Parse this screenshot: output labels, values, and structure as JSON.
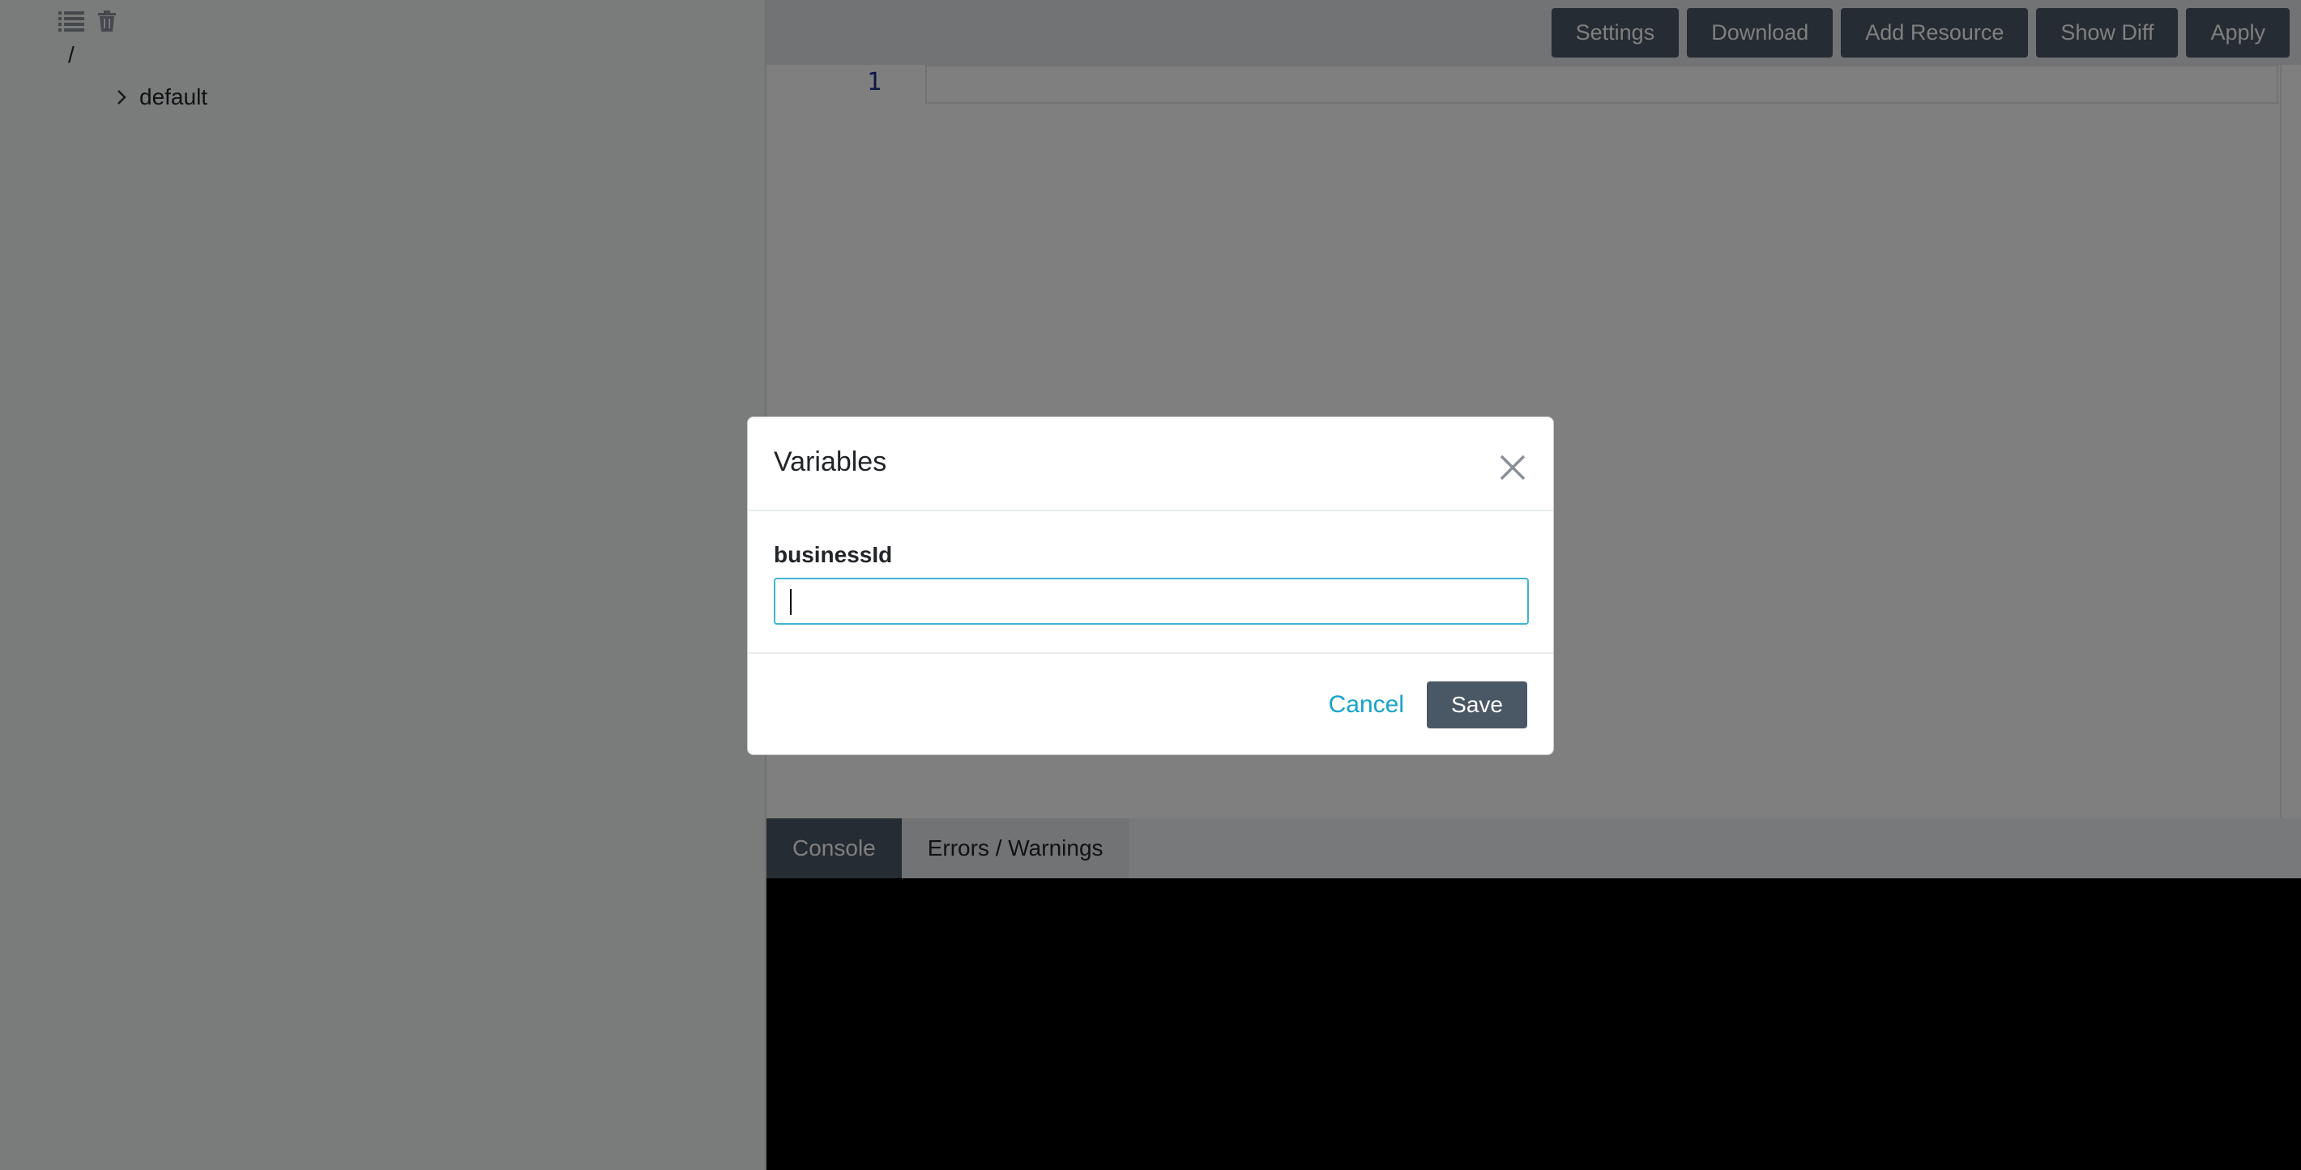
{
  "sidebar": {
    "icons": [
      "list-icon",
      "trash-icon"
    ],
    "tree_root": "/",
    "tree_items": [
      {
        "label": "default",
        "expanded": false
      }
    ]
  },
  "toolbar": {
    "buttons": [
      "Settings",
      "Download",
      "Add Resource",
      "Show Diff",
      "Apply"
    ]
  },
  "editor": {
    "line_numbers": [
      "1"
    ]
  },
  "panel": {
    "tabs": [
      "Console",
      "Errors / Warnings"
    ],
    "active_tab": "Console"
  },
  "modal": {
    "title": "Variables",
    "field_label": "businessId",
    "field_value": "",
    "cancel_label": "Cancel",
    "save_label": "Save"
  },
  "colors": {
    "button_bg": "#4a5866",
    "link": "#17a2c8",
    "input_focus_border": "#42b5d2",
    "console_bg": "#000000"
  }
}
